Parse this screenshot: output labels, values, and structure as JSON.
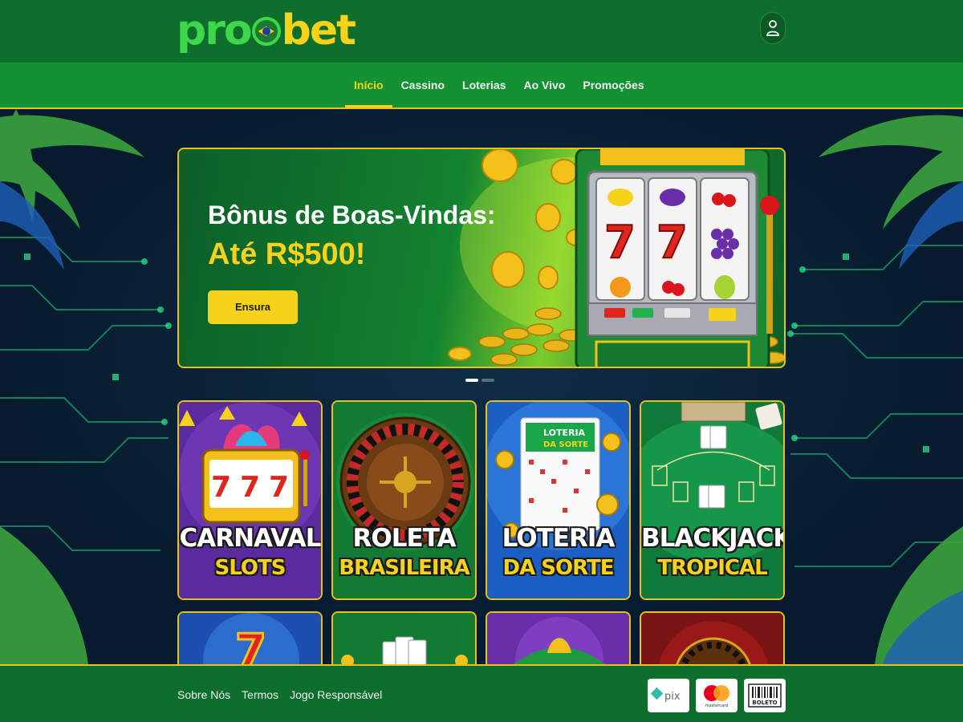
{
  "header": {
    "logo_part1": "pro",
    "logo_part2": "bet"
  },
  "nav": {
    "items": [
      {
        "label": "Início",
        "active": true
      },
      {
        "label": "Cassino",
        "active": false
      },
      {
        "label": "Loterias",
        "active": false
      },
      {
        "label": "Ao Vivo",
        "active": false
      },
      {
        "label": "Promoções",
        "active": false
      }
    ]
  },
  "hero": {
    "title": "Bônus de Boas-Vindas:",
    "subtitle": "Até R$500!",
    "cta_label": "Ensura",
    "slides_total": 2,
    "slide_active": 1
  },
  "games": [
    {
      "line1": "CARNAVAL",
      "line2": "SLOTS"
    },
    {
      "line1": "ROLETA",
      "line2": "BRASILEIRA"
    },
    {
      "line1": "LOTERIA",
      "line2": "DA SORTE"
    },
    {
      "line1": "BLACKJACK",
      "line2": "TROPICAL"
    }
  ],
  "footer": {
    "links": [
      "Sobre Nós",
      "Termos",
      "Jogo Responsável"
    ],
    "payments": [
      "pix",
      "mastercard",
      "BOLETO"
    ]
  },
  "colors": {
    "primary_green": "#0e6f2c",
    "nav_green": "#149233",
    "accent_yellow": "#f7d21b",
    "border_gold": "#e6c21a"
  }
}
